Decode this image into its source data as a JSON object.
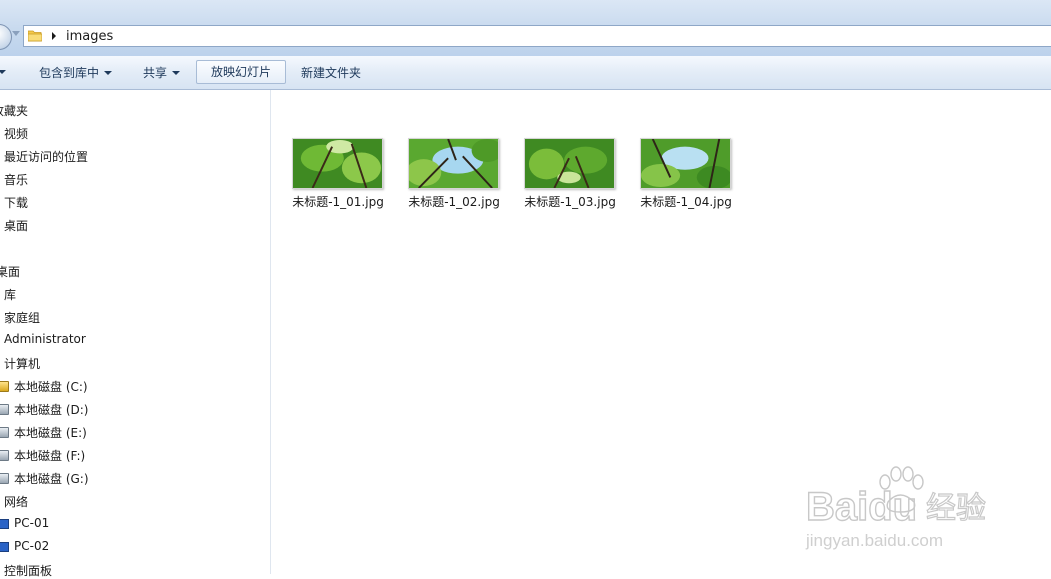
{
  "address_bar": {
    "path": "images"
  },
  "toolbar": {
    "include_in_library": "包含到库中",
    "share": "共享",
    "slideshow": "放映幻灯片",
    "new_folder": "新建文件夹"
  },
  "nav": {
    "favorites": "收藏夹",
    "videos": "视频",
    "recent_places": "最近访问的位置",
    "music": "音乐",
    "downloads": "下载",
    "desktop_fav": "桌面",
    "desktop": "桌面",
    "libraries": "库",
    "homegroup": "家庭组",
    "administrator": "Administrator",
    "computer": "计算机",
    "drive_c": "本地磁盘 (C:)",
    "drive_d": "本地磁盘 (D:)",
    "drive_e": "本地磁盘 (E:)",
    "drive_f": "本地磁盘 (F:)",
    "drive_g": "本地磁盘 (G:)",
    "network": "网络",
    "pc01": "PC-01",
    "pc02": "PC-02",
    "control_panel": "控制面板"
  },
  "files": [
    {
      "name": "未标题-1_01.jpg"
    },
    {
      "name": "未标题-1_02.jpg"
    },
    {
      "name": "未标题-1_03.jpg"
    },
    {
      "name": "未标题-1_04.jpg"
    }
  ],
  "watermark": {
    "brand": "Baidu",
    "jingyan": "经验",
    "url": "jingyan.baidu.com"
  }
}
